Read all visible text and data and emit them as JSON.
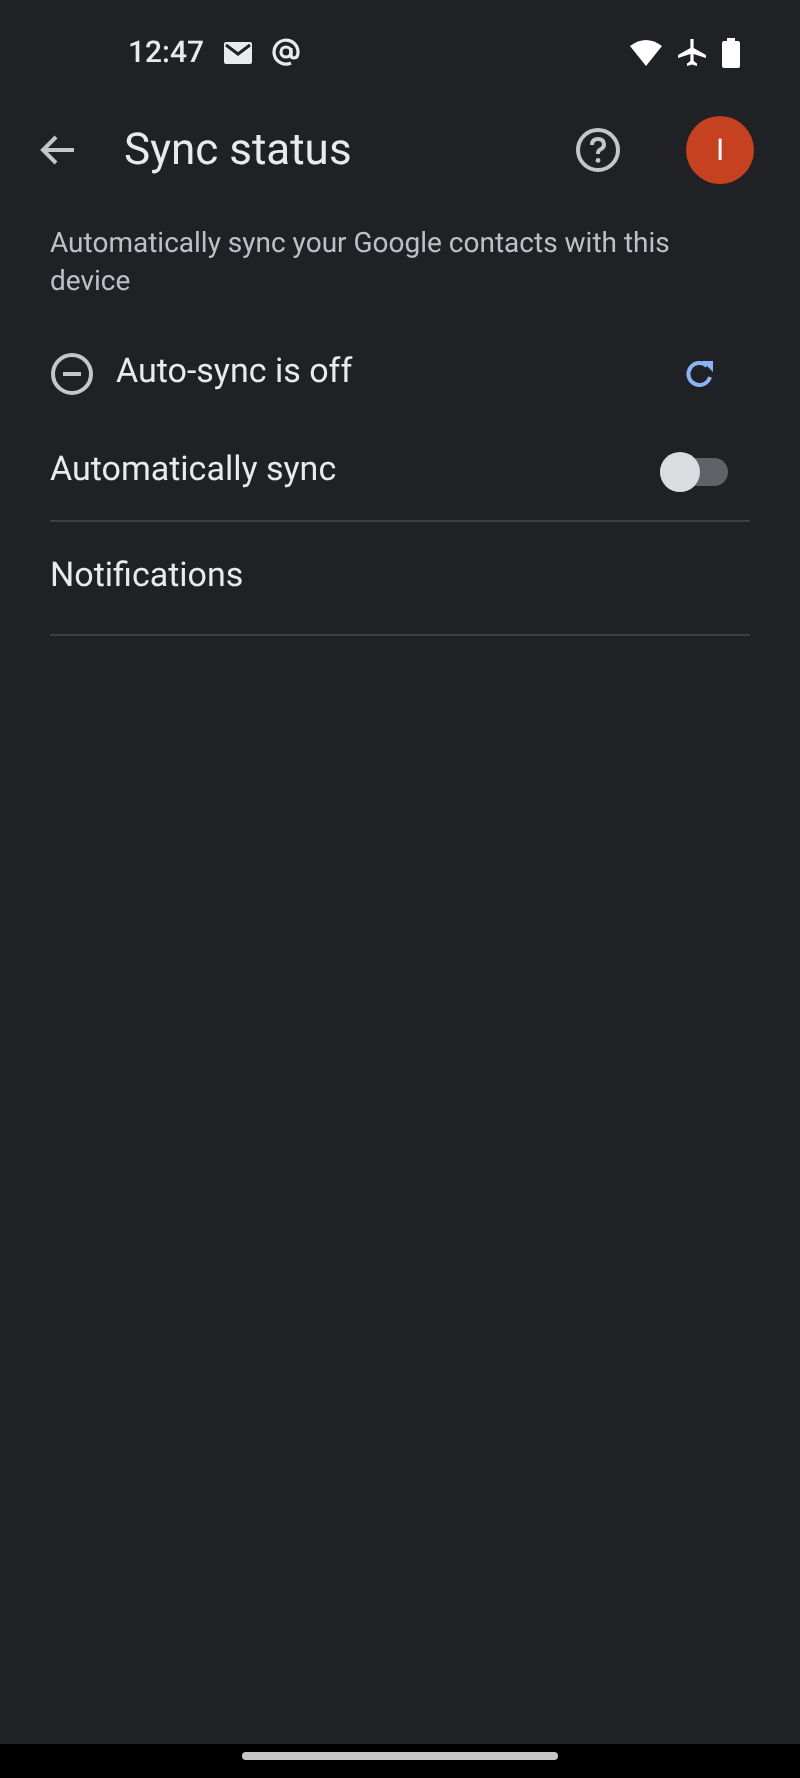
{
  "status_bar": {
    "time": "12:47"
  },
  "app_bar": {
    "title": "Sync status",
    "avatar_letter": "I"
  },
  "description": "Automatically sync your Google contacts with this device",
  "sync_status": {
    "label": "Auto-sync is off"
  },
  "settings": [
    {
      "kind": "toggle",
      "label": "Automatically sync",
      "on": false
    },
    {
      "kind": "link",
      "label": "Notifications"
    }
  ]
}
